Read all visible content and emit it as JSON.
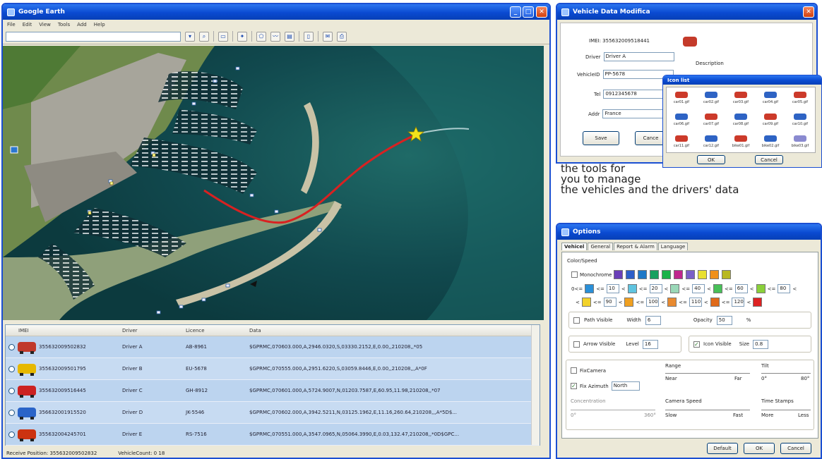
{
  "earth": {
    "title": "Google Earth",
    "menu": [
      "File",
      "Edit",
      "View",
      "Tools",
      "Add",
      "Help"
    ]
  },
  "table": {
    "headers": [
      "IMEI",
      "Driver",
      "Licence",
      "Data"
    ],
    "rows": [
      {
        "imei": "355632009502832",
        "driver": "Driver A",
        "licence": "AB-8961",
        "data": "$GPRMC,070603.000,A,2946.0320,S,03330.2152,E,0.00,,210208,,*05",
        "color": "#c0392b"
      },
      {
        "imei": "355632009501795",
        "driver": "Driver B",
        "licence": "EU-5678",
        "data": "$GPRMC,070555.000,A,2951.6220,S,03059.8446,E,0.00,,210208,,,A*0F",
        "color": "#e6b800"
      },
      {
        "imei": "355632009516445",
        "driver": "Driver C",
        "licence": "GH-8912",
        "data": "$GPRMC,070601.000,A,5724.9007,N,01203.7587,E,60.95,11.98,210208,,*07",
        "color": "#cc2222"
      },
      {
        "imei": "356632001915520",
        "driver": "Driver D",
        "licence": "JK-5546",
        "data": "$GPRMC,070602.000,A,3942.5211,N,03125.1962,E,11.16,260.64,210208,,,A*5D$...",
        "color": "#2a64c8"
      },
      {
        "imei": "355632004245701",
        "driver": "Driver E",
        "licence": "RS-7516",
        "data": "$GPRMC,070551.000,A,3547.0965,N,05064.3990,E,0.03,132.47,210208,,*0D$GPC...",
        "color": "#cc3311"
      }
    ]
  },
  "status": {
    "position": "Receive Position: 355632009502832",
    "count": "VehicleCount: 0 18"
  },
  "vehicle": {
    "title": "Vehicle Data Modifica",
    "imei": "IMEI: 355632009518441",
    "driver_label": "Driver",
    "driver": "Driver A",
    "vehicleid_label": "VehicleID",
    "vehicleid": "PP-5678",
    "tel_label": "Tel",
    "tel": "0912345678",
    "addr_label": "Addr",
    "addr": "France",
    "desc_label": "Description",
    "save": "Save",
    "cancel": "Cance"
  },
  "iconlist": {
    "title": "Icon list",
    "icons": [
      {
        "label": "car01.gif",
        "color": "#cc3a2a"
      },
      {
        "label": "car02.gif",
        "color": "#2e63c4"
      },
      {
        "label": "car03.gif",
        "color": "#cc3a2a"
      },
      {
        "label": "car04.gif",
        "color": "#2e63c4"
      },
      {
        "label": "car05.gif",
        "color": "#cc3a2a"
      },
      {
        "label": "car06.gif",
        "color": "#2e63c4"
      },
      {
        "label": "car07.gif",
        "color": "#cc3a2a"
      },
      {
        "label": "car08.gif",
        "color": "#2e63c4"
      },
      {
        "label": "car09.gif",
        "color": "#cc3a2a"
      },
      {
        "label": "car10.gif",
        "color": "#2e63c4"
      },
      {
        "label": "car11.gif",
        "color": "#cc3a2a"
      },
      {
        "label": "car12.gif",
        "color": "#2e63c4"
      },
      {
        "label": "bike01.gif",
        "color": "#cc3a2a"
      },
      {
        "label": "bike02.gif",
        "color": "#2e63c4"
      },
      {
        "label": "bike03.gif",
        "color": "#8a8ad0"
      }
    ],
    "ok": "OK",
    "cancel": "Cancel"
  },
  "caption": {
    "line1": "the tools for",
    "line2": "you to manage",
    "line3": "the vehicles and the drivers' data"
  },
  "options": {
    "title": "Options",
    "tabs": [
      "Vehicel",
      "General",
      "Report & Alarm",
      "Language"
    ],
    "color_speed": "Color/Speed",
    "monochrome": "Monochrome",
    "swatches": [
      "#6a3fb8",
      "#2d5fc9",
      "#1f78c7",
      "#18a060",
      "#1bb24a",
      "#c0268e",
      "#7a5fc8",
      "#e8e030",
      "#f0901a",
      "#b8b820"
    ],
    "row1": {
      "prefix": "0<=",
      "ranges": [
        "10",
        "20",
        "40",
        "60",
        "80"
      ],
      "colors": [
        "#2a8fd8",
        "#5fc4e0",
        "#9ad8b8",
        "#48c058",
        "#8ad03a"
      ]
    },
    "row2": {
      "prefix": "<",
      "ranges": [
        "90",
        "100",
        "110",
        "120"
      ],
      "colors": [
        "#f2d22a",
        "#f0a020",
        "#e88a30",
        "#e06a1a",
        "#dd2222"
      ]
    },
    "path_visible": "Path Visible",
    "width_label": "Width",
    "width": "6",
    "opacity_label": "Opacity",
    "opacity": "50",
    "pct": "%",
    "arrow_visible": "Arrow Visible",
    "level_label": "Level",
    "level": "16",
    "icon_visible": "Icon Visible",
    "size_label": "Size",
    "size": "0.8",
    "fixcamera": "FixCamera",
    "fix_azimuth": "Fix Azimuth",
    "azimuth": "North",
    "range": "Range",
    "near": "Near",
    "far": "Far",
    "tilt": "Tilt",
    "tilt_min": "0°",
    "tilt_max": "80°",
    "concentration": "Concentration",
    "conc_min": "0°",
    "conc_max": "360°",
    "camera_speed": "Camera Speed",
    "slow": "Slow",
    "fast": "Fast",
    "time_stamps": "Time Stamps",
    "more": "More",
    "less": "Less",
    "default": "Default",
    "ok": "OK",
    "cancel": "Cancel"
  }
}
